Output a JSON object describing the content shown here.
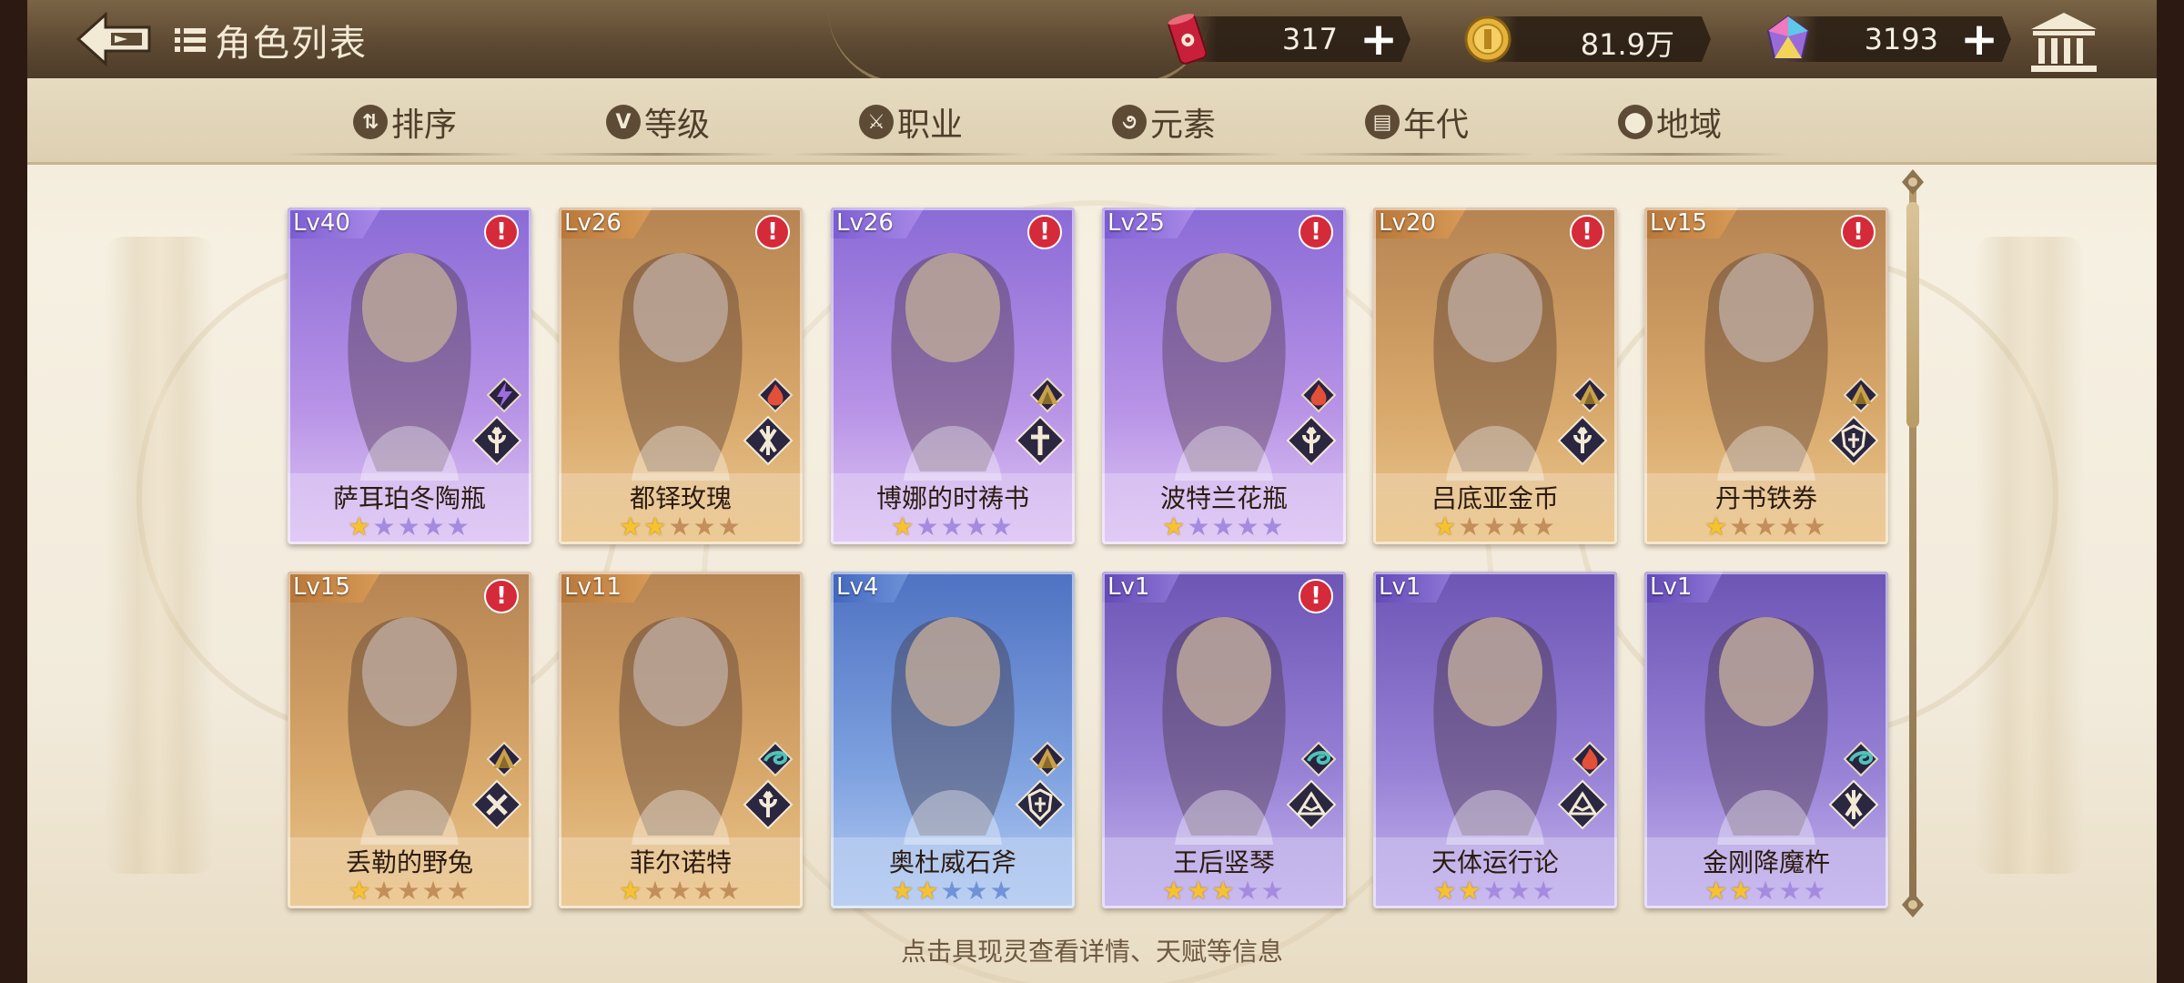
{
  "header": {
    "title": "角色列表",
    "currencies": [
      {
        "name": "ticket",
        "icon": "ticket-can-icon",
        "value": "317",
        "color": "#c8203a"
      },
      {
        "name": "gold",
        "icon": "gold-coin-icon",
        "value": "81.9万",
        "color": "#e5b23a"
      },
      {
        "name": "gem",
        "icon": "rainbow-gem-icon",
        "value": "3193",
        "color": "#9a6bd8"
      }
    ]
  },
  "filters": [
    {
      "label": "排序",
      "icon": "sort-icon",
      "glyph": "⇅"
    },
    {
      "label": "等级",
      "icon": "level-icon",
      "glyph": "V"
    },
    {
      "label": "职业",
      "icon": "class-icon",
      "glyph": "⚔"
    },
    {
      "label": "元素",
      "icon": "element-icon",
      "glyph": "૭"
    },
    {
      "label": "年代",
      "icon": "era-icon",
      "glyph": "▤"
    },
    {
      "label": "地域",
      "icon": "region-icon",
      "glyph": "⬤"
    }
  ],
  "cards": [
    {
      "level": "Lv40",
      "name": "萨耳珀冬陶瓶",
      "stars": 1,
      "theme": "purple",
      "alert": true,
      "element": "lightning",
      "class": "lance"
    },
    {
      "level": "Lv26",
      "name": "都铎玫瑰",
      "stars": 2,
      "theme": "gold",
      "alert": true,
      "element": "fire",
      "class": "bow"
    },
    {
      "level": "Lv26",
      "name": "博娜的时祷书",
      "stars": 1,
      "theme": "purple",
      "alert": true,
      "element": "earth",
      "class": "holy"
    },
    {
      "level": "Lv25",
      "name": "波特兰花瓶",
      "stars": 1,
      "theme": "purple",
      "alert": true,
      "element": "fire",
      "class": "lance"
    },
    {
      "level": "Lv20",
      "name": "吕底亚金币",
      "stars": 1,
      "theme": "gold",
      "alert": true,
      "element": "earth",
      "class": "lance"
    },
    {
      "level": "Lv15",
      "name": "丹书铁券",
      "stars": 1,
      "theme": "gold",
      "alert": true,
      "element": "earth",
      "class": "shield"
    },
    {
      "level": "Lv15",
      "name": "丢勒的野兔",
      "stars": 1,
      "theme": "gold",
      "alert": true,
      "element": "earth",
      "class": "tools"
    },
    {
      "level": "Lv11",
      "name": "菲尔诺特",
      "stars": 1,
      "theme": "gold",
      "alert": false,
      "element": "wind",
      "class": "lance"
    },
    {
      "level": "Lv4",
      "name": "奥杜威石斧",
      "stars": 2,
      "theme": "blue",
      "alert": false,
      "element": "earth",
      "class": "shield"
    },
    {
      "level": "Lv1",
      "name": "王后竖琴",
      "stars": 3,
      "theme": "violet",
      "alert": true,
      "element": "wind",
      "class": "book"
    },
    {
      "level": "Lv1",
      "name": "天体运行论",
      "stars": 2,
      "theme": "violet",
      "alert": false,
      "element": "fire",
      "class": "book"
    },
    {
      "level": "Lv1",
      "name": "金刚降魔杵",
      "stars": 2,
      "theme": "violet",
      "alert": false,
      "element": "wind",
      "class": "bow"
    }
  ],
  "max_stars": 5,
  "hint": "点击具现灵查看详情、天赋等信息"
}
